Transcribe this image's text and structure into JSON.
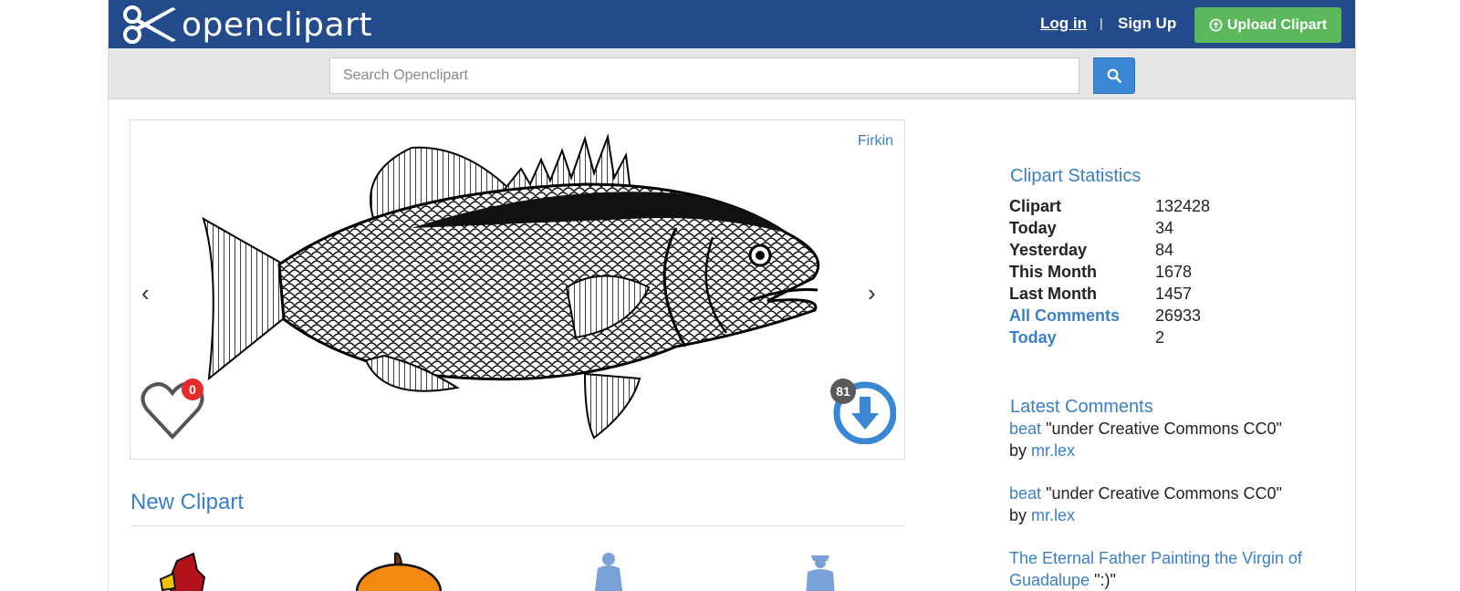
{
  "header": {
    "logo_text": "openclipart",
    "login_label": "Log in",
    "separator": "|",
    "signup_label": "Sign Up",
    "upload_label": "Upload Clipart"
  },
  "search": {
    "placeholder": "Search Openclipart"
  },
  "featured": {
    "author": "Firkin",
    "prev_arrow": "‹",
    "next_arrow": "›",
    "likes": "0",
    "downloads": "81"
  },
  "new_clipart": {
    "title": "New Clipart"
  },
  "stats": {
    "title": "Clipart Statistics",
    "rows": [
      {
        "label": "Clipart",
        "value": "132428"
      },
      {
        "label": "Today",
        "value": "34"
      },
      {
        "label": "Yesterday",
        "value": "84"
      },
      {
        "label": "This Month",
        "value": "1678"
      },
      {
        "label": "Last Month",
        "value": "1457"
      },
      {
        "label": "All Comments",
        "value": "26933"
      },
      {
        "label": "Today",
        "value": "2"
      }
    ]
  },
  "comments": {
    "title": "Latest Comments",
    "items": [
      {
        "author": "beat",
        "text": "\"under Creative Commons CC0\"",
        "by": "by",
        "target": "mr.lex"
      },
      {
        "author": "beat",
        "text": "\"under Creative Commons CC0\"",
        "by": "by",
        "target": "mr.lex"
      },
      {
        "title": "The Eternal Father Painting the Virgin of Guadalupe",
        "text": "\":)\""
      }
    ]
  },
  "colors": {
    "nav_bg": "#234b8b",
    "accent_blue": "#3a7fc8",
    "upload_green": "#5cb85c",
    "badge_red": "#e52b2b"
  }
}
